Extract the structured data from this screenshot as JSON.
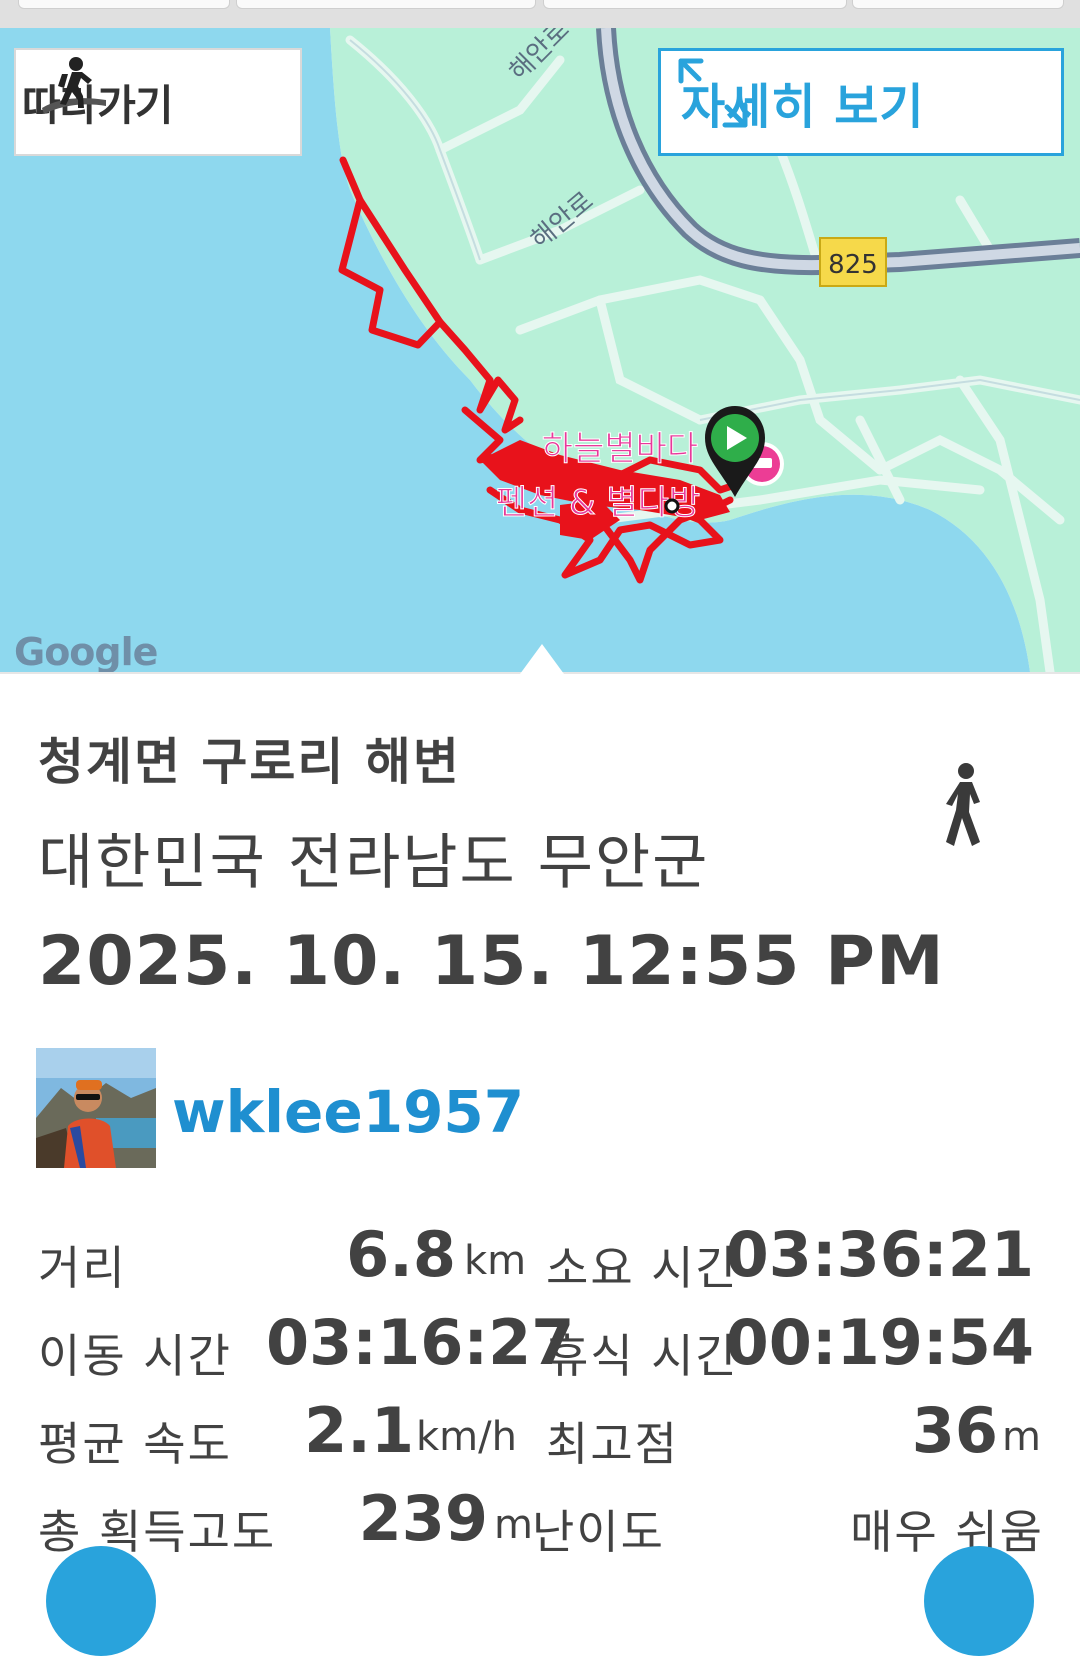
{
  "map": {
    "follow_label": "따라가기",
    "detail_label": "자세히 보기",
    "road_labels": [
      "해안로",
      "해안로"
    ],
    "route_number": "825",
    "poi_name_line1": "하늘별바다",
    "poi_name_line2": "펜션 & 별다방",
    "attribution": "Google",
    "route_color": "#e8121b",
    "sea_color": "#8ed8ee",
    "land_color": "#b8f0d8"
  },
  "trip": {
    "title": "청계면 구로리 해변",
    "region": "대한민국 전라남도 무안군",
    "datetime": "2025. 10. 15. 12:55 PM",
    "activity_icon": "walking-icon",
    "username": "wklee1957"
  },
  "stats": {
    "distance_label": "거리",
    "distance_value": "6.8",
    "distance_unit": "km",
    "elapsed_label": "소요 시간",
    "elapsed_value": "03:36:21",
    "moving_label": "이동 시간",
    "moving_value": "03:16:27",
    "rest_label": "휴식 시간",
    "rest_value": "00:19:54",
    "avg_speed_label": "평균 속도",
    "avg_speed_value": "2.1",
    "avg_speed_unit": "km/h",
    "max_alt_label": "최고점",
    "max_alt_value": "36",
    "max_alt_unit": "m",
    "gain_label": "총 획득고도",
    "gain_value": "239",
    "gain_unit": "m",
    "difficulty_label": "난이도",
    "difficulty_value": "매우 쉬움"
  },
  "colors": {
    "accent": "#29a3dc",
    "username": "#1f8fd0",
    "text": "#424242"
  }
}
